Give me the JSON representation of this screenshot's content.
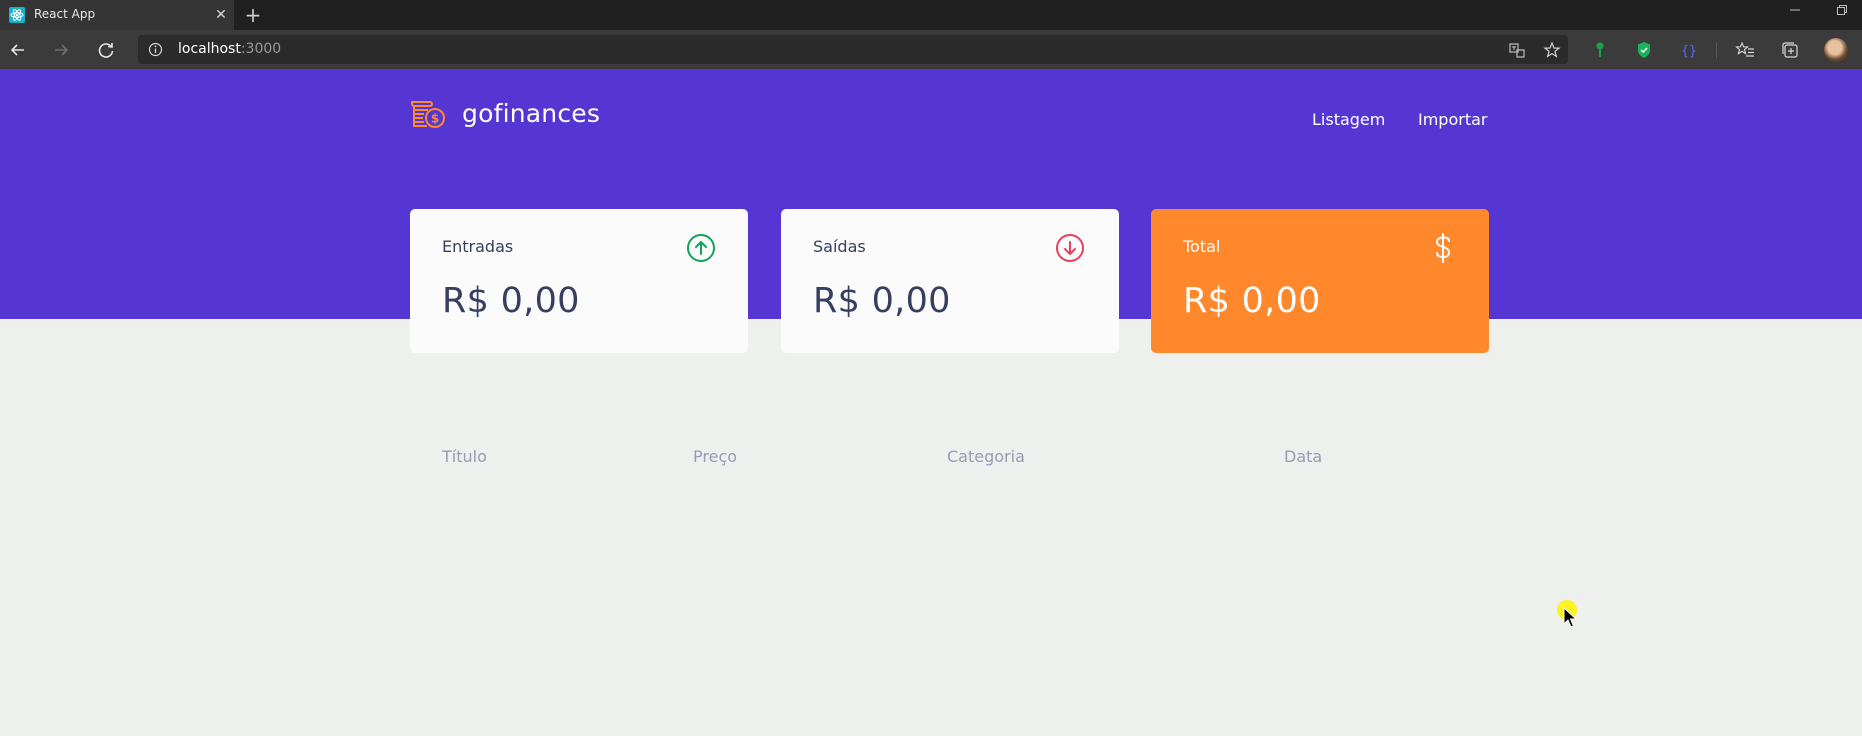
{
  "browser": {
    "tab": {
      "title": "React App",
      "favicon": "react-icon",
      "close_glyph": "✕"
    },
    "new_tab_glyph": "+",
    "address": {
      "host": "localhost",
      "port": ":3000"
    },
    "icons": [
      "back-icon",
      "forward-icon",
      "reload-icon",
      "info-icon",
      "translate-icon",
      "favorite-star-icon",
      "extension-key-icon",
      "extension-shield-icon",
      "extension-braces-icon",
      "favorites-icon",
      "collections-icon",
      "profile-avatar"
    ]
  },
  "app": {
    "brand": {
      "name": "gofinances",
      "icon": "coins-dollar-icon"
    },
    "nav": [
      {
        "label": "Listagem"
      },
      {
        "label": "Importar"
      }
    ],
    "cards": [
      {
        "title": "Entradas",
        "value": "R$ 0,00",
        "icon": "arrow-up-circle-icon",
        "icon_color": "#12a454"
      },
      {
        "title": "Saídas",
        "value": "R$ 0,00",
        "icon": "arrow-down-circle-icon",
        "icon_color": "#e83f5b"
      },
      {
        "title": "Total",
        "value": "R$ 0,00",
        "icon": "dollar-sign-icon",
        "icon_color": "#ffffff"
      }
    ],
    "table": {
      "headers": [
        "Título",
        "Preço",
        "Categoria",
        "Data"
      ],
      "rows": []
    },
    "colors": {
      "primary": "#5636d3",
      "background": "#f0f2f5",
      "card": "#ffffff",
      "total_card": "#ff872c",
      "text": "#363f5f",
      "muted": "#969cb3",
      "income": "#12a454",
      "outcome": "#e83f5b"
    }
  }
}
